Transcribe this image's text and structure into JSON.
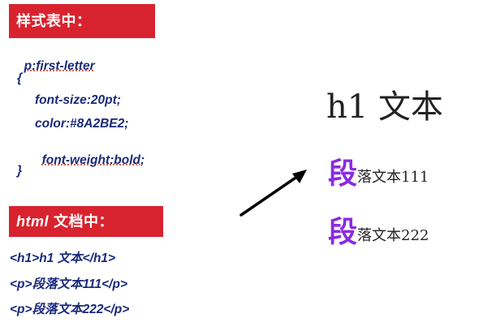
{
  "css_section": {
    "label": "样式表中：",
    "lines": [
      "p:first-letter",
      "{",
      "font-size:20pt;",
      "color:#8A2BE2;",
      "font-weight:bold;",
      "}"
    ]
  },
  "html_section": {
    "label_italic": "html",
    "label_rest": "文档中：",
    "lines": [
      "<h1>h1 文本</h1>",
      "<p>段落文本111</p>",
      "<p>段落文本222</p>"
    ]
  },
  "preview": {
    "heading": "h1  文本",
    "paragraphs": [
      {
        "first_letter": "段",
        "rest": "落文本111"
      },
      {
        "first_letter": "段",
        "rest": "落文本222"
      }
    ]
  },
  "colors": {
    "label_background": "#d8232f",
    "code_text": "#1a2a7a",
    "first_letter": "#8A2BE2"
  },
  "icons": {
    "arrow": "arrow-up-right-icon"
  }
}
